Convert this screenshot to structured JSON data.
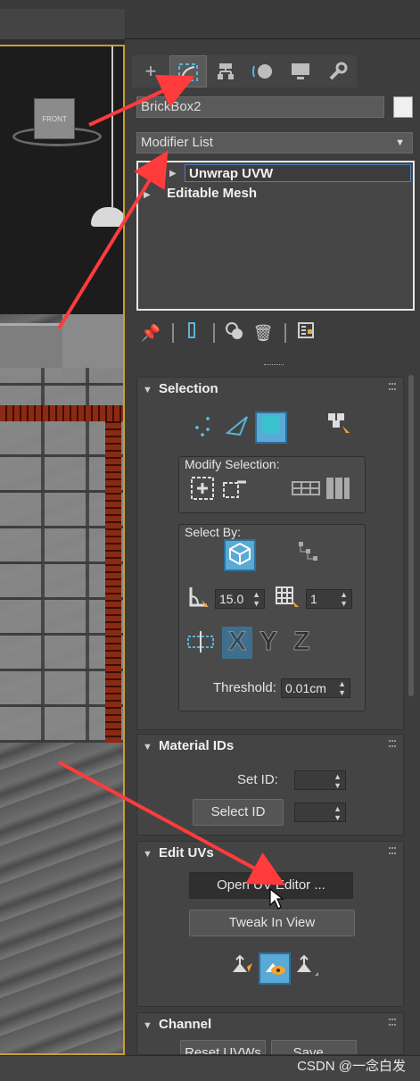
{
  "object_name": "BrickBox2",
  "modifier_list": {
    "label": "Modifier List"
  },
  "stack": {
    "items": [
      {
        "label": "Unwrap UVW"
      },
      {
        "label": "Editable Mesh"
      }
    ]
  },
  "command_tabs": [
    "create-icon",
    "modify-icon",
    "hierarchy-icon",
    "motion-icon",
    "display-icon",
    "utilities-icon"
  ],
  "viewport": {
    "viewcube_label": "FRONT"
  },
  "selection": {
    "title": "Selection",
    "modify_selection_label": "Modify Selection:",
    "select_by_label": "Select By:",
    "angle_value": "15.0",
    "count_value": "1",
    "threshold_label": "Threshold:",
    "threshold_value": "0.01cm",
    "axes": [
      "X",
      "Y",
      "Z"
    ]
  },
  "material_ids": {
    "title": "Material IDs",
    "set_id_label": "Set ID:",
    "select_id_button": "Select ID"
  },
  "edit_uvs": {
    "title": "Edit UVs",
    "open_uv_editor_button": "Open UV Editor ...",
    "tweak_in_view_button": "Tweak In View"
  },
  "channel": {
    "title": "Channel",
    "reset_button": "Reset UVWs",
    "save_button": "Save..."
  },
  "watermark": "CSDN @一念白发",
  "colors": {
    "accent": "#5aa9d6",
    "arrow": "#ff3b3b",
    "viewport_border": "#c8a032"
  }
}
